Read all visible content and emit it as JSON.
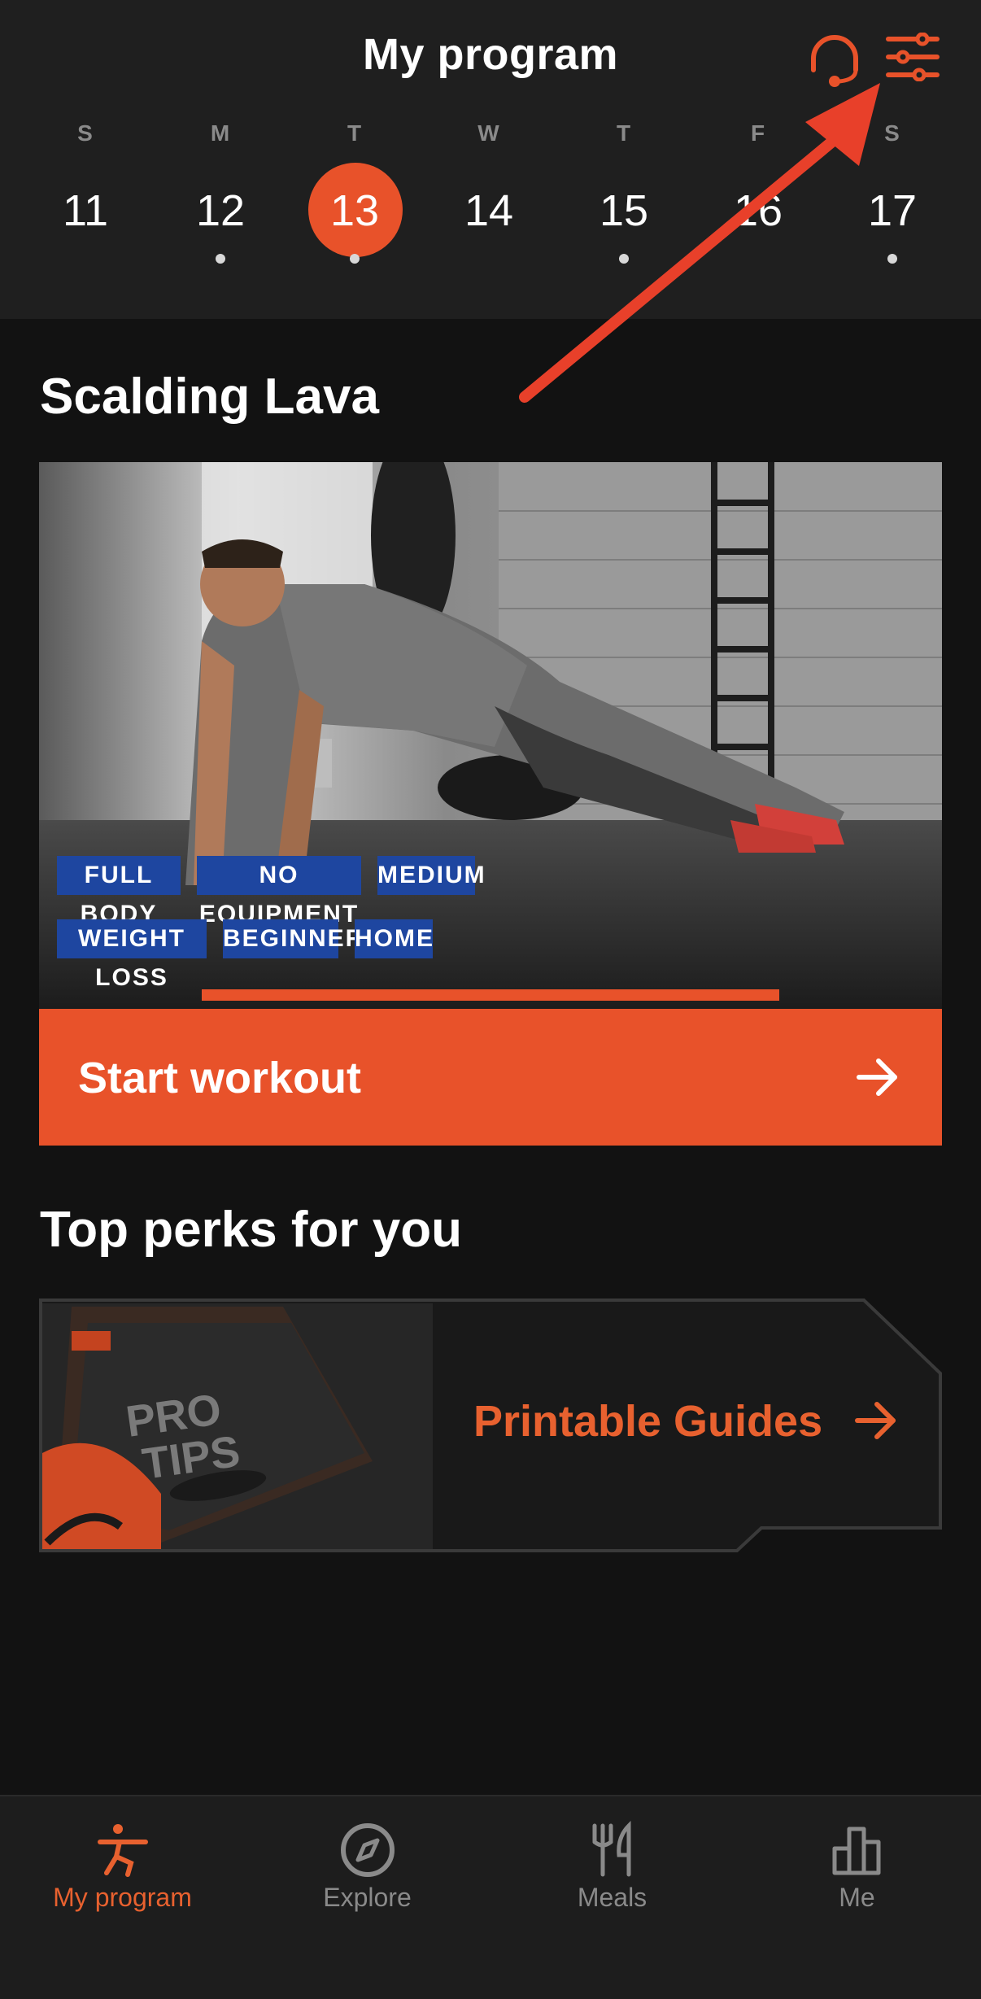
{
  "header": {
    "title": "My program",
    "support_icon": "headset-icon",
    "filter_icon": "sliders-icon"
  },
  "week": {
    "days": [
      {
        "letter": "S",
        "number": "11",
        "dot": false,
        "selected": false
      },
      {
        "letter": "M",
        "number": "12",
        "dot": true,
        "selected": false
      },
      {
        "letter": "T",
        "number": "13",
        "dot": true,
        "selected": true
      },
      {
        "letter": "W",
        "number": "14",
        "dot": false,
        "selected": false
      },
      {
        "letter": "T",
        "number": "15",
        "dot": true,
        "selected": false
      },
      {
        "letter": "F",
        "number": "16",
        "dot": false,
        "selected": false
      },
      {
        "letter": "S",
        "number": "17",
        "dot": true,
        "selected": false
      }
    ]
  },
  "workout": {
    "title": "Scalding Lava",
    "tags": [
      "FULL BODY",
      "NO EQUIPMENT",
      "MEDIUM",
      "WEIGHT LOSS",
      "BEGINNER",
      "HOME"
    ],
    "progress": 0.64,
    "start_label": "Start workout"
  },
  "perks": {
    "title": "Top perks for you",
    "card_label": "Printable Guides",
    "book_cover_text": "PRO TIPS"
  },
  "bottom_nav": {
    "items": [
      {
        "label": "My program",
        "icon": "exercise-figure-icon",
        "active": true
      },
      {
        "label": "Explore",
        "icon": "compass-icon",
        "active": false
      },
      {
        "label": "Meals",
        "icon": "fork-knife-icon",
        "active": false
      },
      {
        "label": "Me",
        "icon": "bar-chart-icon",
        "active": false
      }
    ]
  },
  "colors": {
    "accent": "#e8522a",
    "tag_blue": "#1e46a0",
    "background": "#121212",
    "header_bg": "#1f1f1f",
    "annotation_arrow": "#e8402a"
  }
}
